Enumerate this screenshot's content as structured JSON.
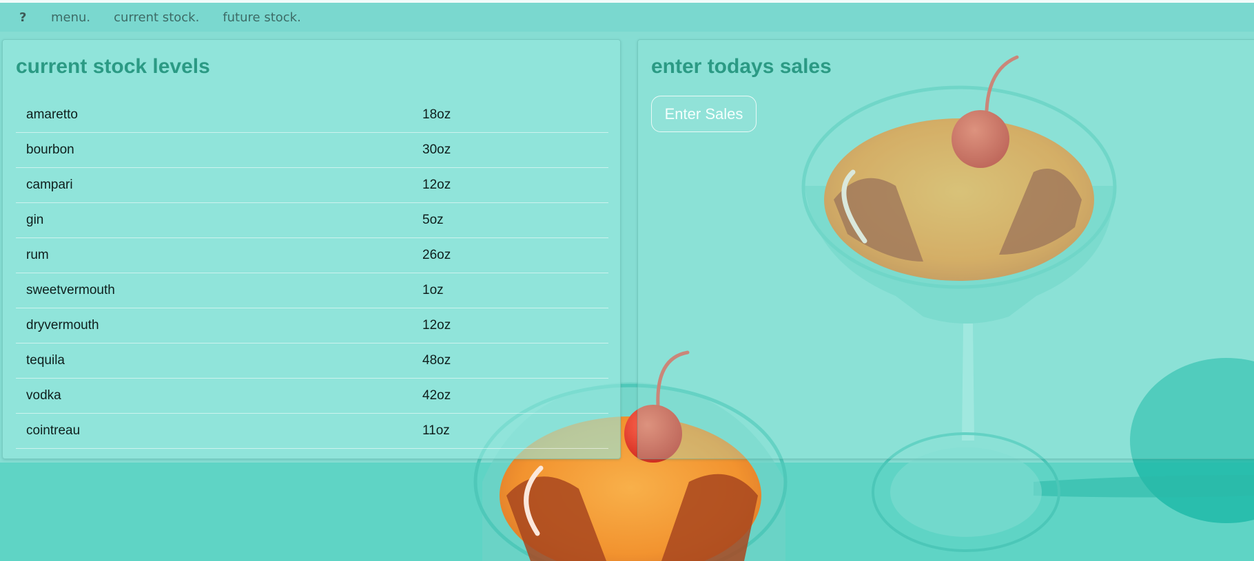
{
  "nav": {
    "brand": "?",
    "links": [
      "menu.",
      "current stock.",
      "future stock."
    ]
  },
  "stock": {
    "title": "current stock levels",
    "items": [
      {
        "name": "amaretto",
        "amount": "18oz"
      },
      {
        "name": "bourbon",
        "amount": "30oz"
      },
      {
        "name": "campari",
        "amount": "12oz"
      },
      {
        "name": "gin",
        "amount": "5oz"
      },
      {
        "name": "rum",
        "amount": "26oz"
      },
      {
        "name": "sweetvermouth",
        "amount": "1oz"
      },
      {
        "name": "dryvermouth",
        "amount": "12oz"
      },
      {
        "name": "tequila",
        "amount": "48oz"
      },
      {
        "name": "vodka",
        "amount": "42oz"
      },
      {
        "name": "cointreau",
        "amount": "11oz"
      }
    ]
  },
  "sales": {
    "title": "enter todays sales",
    "button_label": "Enter Sales"
  },
  "colors": {
    "background": "#79dace",
    "accent": "#2b9a84",
    "cocktail": "#f59a3a",
    "cherry": "#e03b2c"
  },
  "background_image": "two martini glasses with orange cocktails and cherries"
}
